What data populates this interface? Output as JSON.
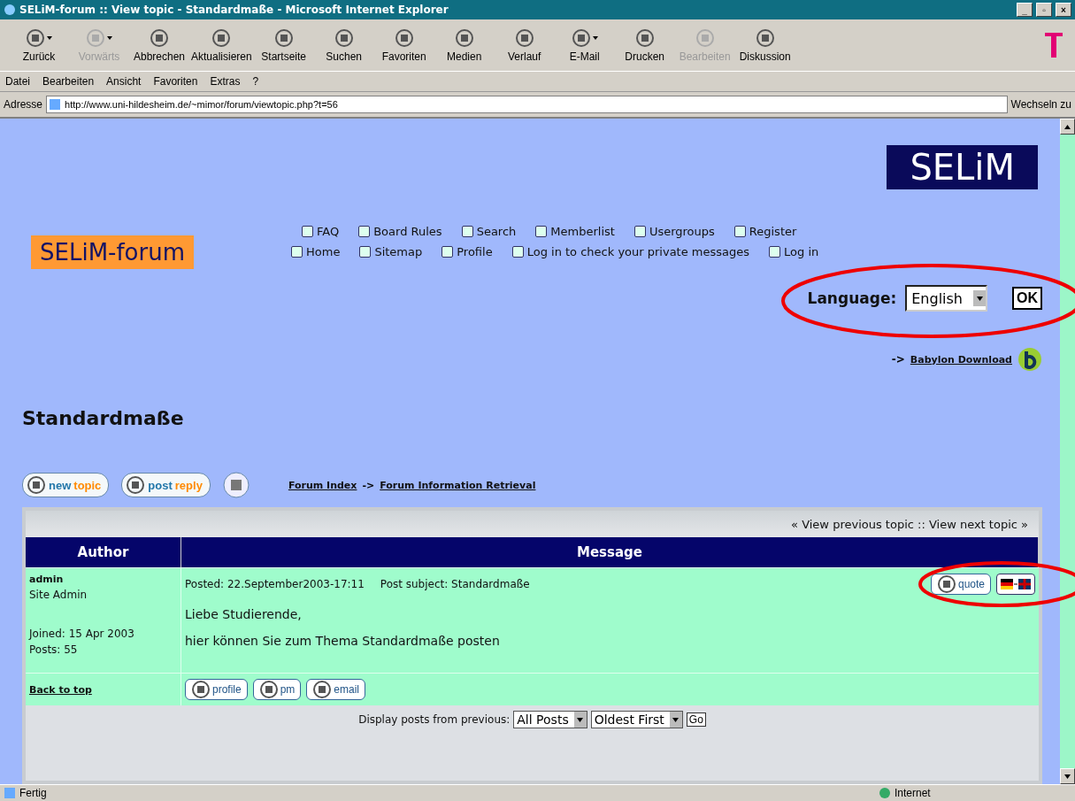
{
  "window": {
    "title": "SELiM-forum :: View topic - Standardmaße - Microsoft Internet Explorer",
    "controls": [
      "_",
      "▫",
      "×"
    ]
  },
  "toolbar": [
    {
      "label": "Zurück",
      "disabled": false,
      "dropdown": true
    },
    {
      "label": "Vorwärts",
      "disabled": true,
      "dropdown": true
    },
    {
      "label": "Abbrechen",
      "disabled": false,
      "dropdown": false
    },
    {
      "label": "Aktualisieren",
      "disabled": false,
      "dropdown": false
    },
    {
      "label": "Startseite",
      "disabled": false,
      "dropdown": false
    },
    {
      "label": "Suchen",
      "disabled": false,
      "dropdown": false
    },
    {
      "label": "Favoriten",
      "disabled": false,
      "dropdown": false
    },
    {
      "label": "Medien",
      "disabled": false,
      "dropdown": false
    },
    {
      "label": "Verlauf",
      "disabled": false,
      "dropdown": false
    },
    {
      "label": "E-Mail",
      "disabled": false,
      "dropdown": true
    },
    {
      "label": "Drucken",
      "disabled": false,
      "dropdown": false
    },
    {
      "label": "Bearbeiten",
      "disabled": true,
      "dropdown": false
    },
    {
      "label": "Diskussion",
      "disabled": false,
      "dropdown": false
    }
  ],
  "menu": [
    "Datei",
    "Bearbeiten",
    "Ansicht",
    "Favoriten",
    "Extras",
    "?"
  ],
  "address": {
    "label": "Adresse",
    "value": "http://www.uni-hildesheim.de/~mimor/forum/viewtopic.php?t=56",
    "go": "Wechseln zu"
  },
  "page": {
    "logo": "SELiM",
    "forum_logo": "SELiM-forum",
    "nav": [
      [
        {
          "label": "FAQ"
        },
        {
          "label": "Board Rules"
        },
        {
          "label": "Search"
        },
        {
          "label": "Memberlist"
        },
        {
          "label": "Usergroups"
        },
        {
          "label": "Register"
        }
      ],
      [
        {
          "label": "Home"
        },
        {
          "label": "Sitemap"
        },
        {
          "label": "Profile"
        },
        {
          "label": "Log in to check your private messages"
        },
        {
          "label": "Log in"
        }
      ]
    ],
    "language": {
      "label": "Language:",
      "value": "English",
      "button": "OK"
    },
    "babylon": {
      "arrow": "->",
      "link": "Babylon Download"
    },
    "topic_title": "Standardmaße",
    "actions": [
      {
        "prefix": "new",
        "suffix": "topic"
      },
      {
        "prefix": "post",
        "suffix": "reply"
      }
    ],
    "breadcrumb": {
      "home": "Forum Index",
      "separator": "->",
      "forum": "Forum Information Retrieval"
    },
    "topic_nav": "« View previous topic :: View next topic »",
    "columns": [
      "Author",
      "Message"
    ],
    "post": {
      "author": "admin",
      "rank": "Site Admin",
      "joined": "Joined: 15 Apr 2003",
      "posts": "Posts: 55",
      "posted": "Posted: 22.September2003-17:11",
      "subject": "Post subject: Standardmaße",
      "body": [
        "Liebe Studierende,",
        "hier können Sie zum Thema Standardmaße posten"
      ],
      "quote": "quote",
      "profile_buttons": [
        "profile",
        "pm",
        "email"
      ],
      "back_to_top": "Back to top"
    },
    "display": {
      "label": "Display posts from previous:",
      "posts": "All Posts",
      "order": "Oldest First",
      "go": "Go"
    }
  },
  "status": {
    "text": "Fertig",
    "zone": "Internet"
  }
}
